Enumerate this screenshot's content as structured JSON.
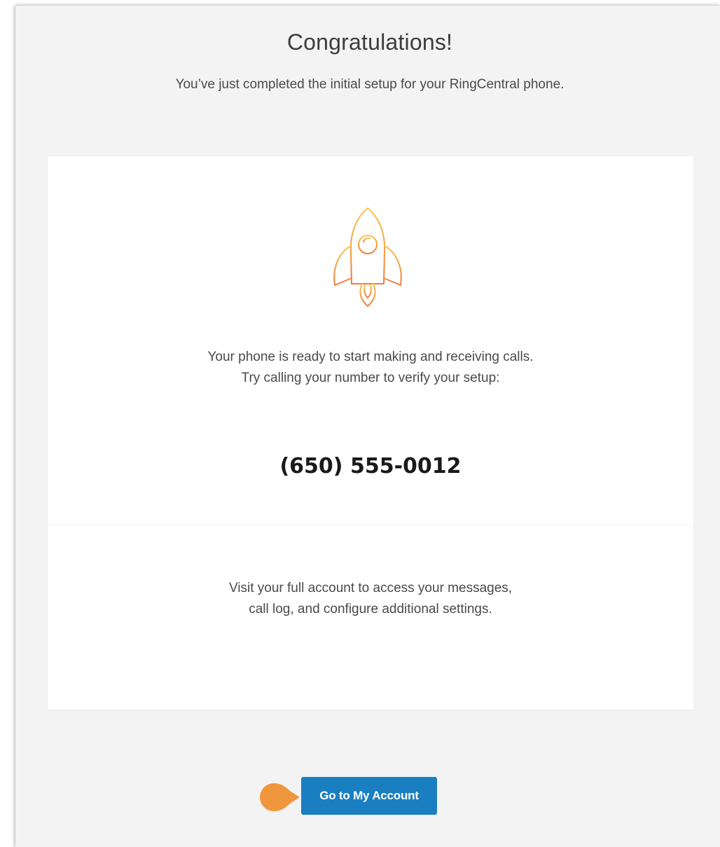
{
  "header": {
    "title": "Congratulations!",
    "subtitle": "You’ve just completed the initial setup for your RingCentral phone."
  },
  "card": {
    "icon": "rocket-icon",
    "ready_line1": "Your phone is ready to start making and receiving calls.",
    "ready_line2": "Try calling your number to verify your setup:",
    "phone_number": "(650) 555-0012",
    "visit_line1": "Visit your full account to access your messages,",
    "visit_line2": "call log, and configure additional settings."
  },
  "actions": {
    "account_button_label": "Go to My Account"
  },
  "colors": {
    "button": "#1a7fc1",
    "marker": "#f0963c",
    "rocket_gradient_top": "#f7c64a",
    "rocket_gradient_bottom": "#f07a3a"
  }
}
